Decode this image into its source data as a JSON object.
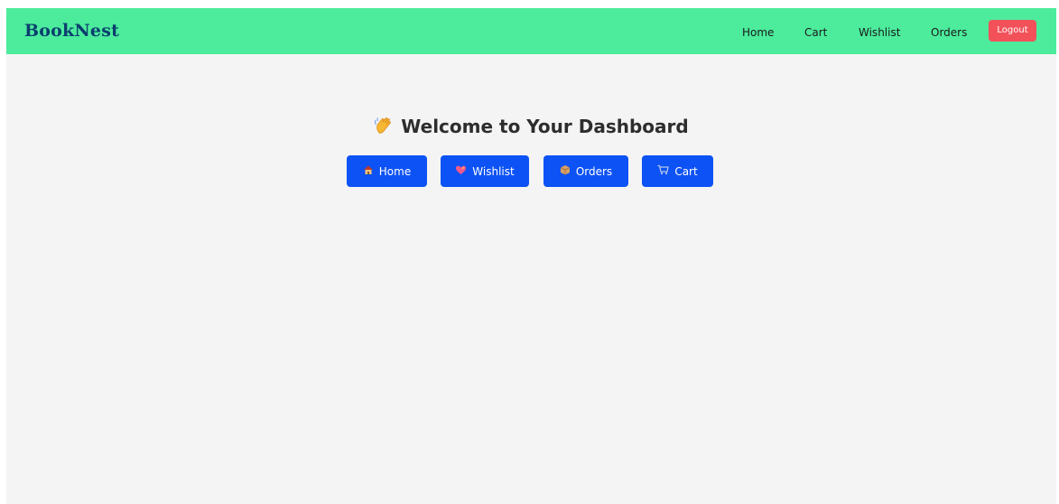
{
  "navbar": {
    "brand": "BookNest",
    "links": [
      "Home",
      "Cart",
      "Wishlist",
      "Orders"
    ],
    "logout_label": "Logout"
  },
  "main": {
    "welcome": "Welcome to Your Dashboard",
    "buttons": [
      {
        "label": "Home",
        "icon": "house-icon"
      },
      {
        "label": "Wishlist",
        "icon": "heart-icon"
      },
      {
        "label": "Orders",
        "icon": "package-icon"
      },
      {
        "label": "Cart",
        "icon": "cart-icon"
      }
    ]
  },
  "colors": {
    "navbar_bg": "#4cec9c",
    "brand": "#0c3e6e",
    "logout_bg": "#f2515a",
    "button_bg": "#0d52f5",
    "page_bg": "#f4f4f4"
  }
}
